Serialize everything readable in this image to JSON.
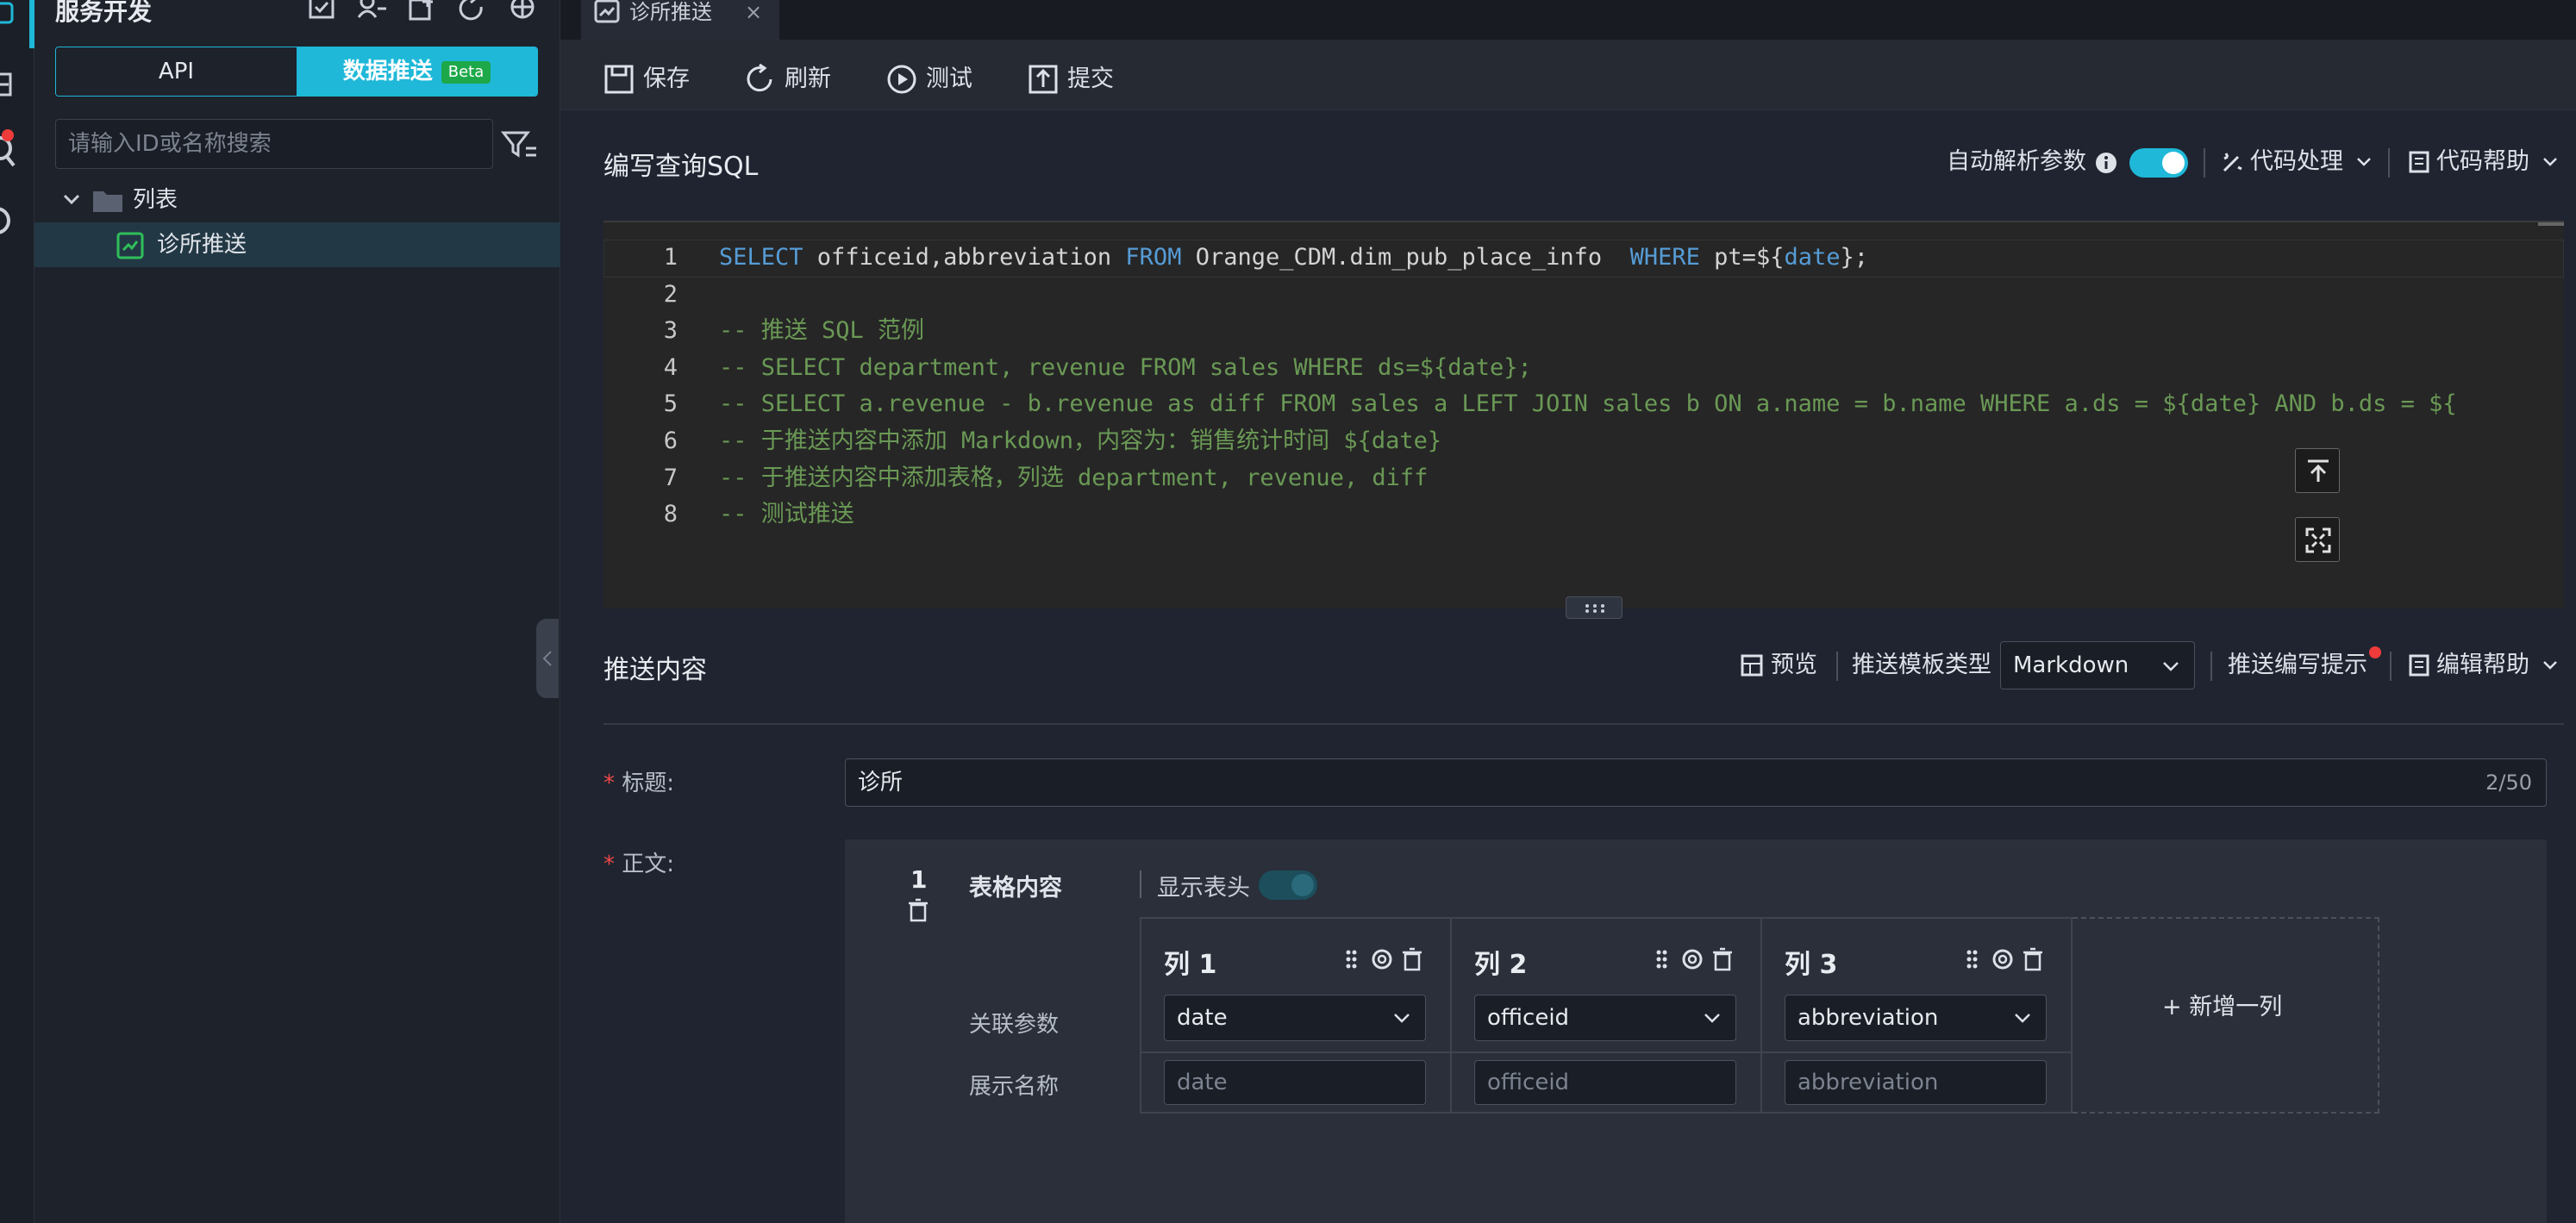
{
  "sidebar": {
    "title": "服务开发",
    "segments": [
      {
        "label": "API",
        "active": false
      },
      {
        "label": "数据推送",
        "badge": "Beta",
        "active": true
      }
    ],
    "search_placeholder": "请输入ID或名称搜索",
    "tree": {
      "folder_label": "列表",
      "items": [
        {
          "label": "诊所推送",
          "selected": true
        }
      ]
    }
  },
  "tabs": [
    {
      "label": "诊所推送",
      "close": "×"
    }
  ],
  "toolbar": {
    "save_label": "保存",
    "refresh_label": "刷新",
    "test_label": "测试",
    "submit_label": "提交"
  },
  "sql_section": {
    "title": "编写查询SQL",
    "auto_parse_label": "自动解析参数",
    "auto_parse_on": true,
    "code_process_label": "代码处理",
    "code_help_label": "代码帮助"
  },
  "code_lines": [
    {
      "n": "1",
      "parts": [
        [
          "kw",
          "SELECT"
        ],
        [
          "tx",
          " officeid,abbreviation "
        ],
        [
          "kw",
          "FROM"
        ],
        [
          "tx",
          " Orange_CDM.dim_pub_place_info  "
        ],
        [
          "kw",
          "WHERE"
        ],
        [
          "tx",
          " pt="
        ],
        [
          "tx",
          "${"
        ],
        [
          "kw",
          "date"
        ],
        [
          "tx",
          "};"
        ]
      ]
    },
    {
      "n": "2",
      "parts": []
    },
    {
      "n": "3",
      "parts": [
        [
          "cm",
          "-- 推送 SQL 范例"
        ]
      ]
    },
    {
      "n": "4",
      "parts": [
        [
          "cm",
          "-- SELECT department, revenue FROM sales WHERE ds=${date};"
        ]
      ]
    },
    {
      "n": "5",
      "parts": [
        [
          "cm",
          "-- SELECT a.revenue - b.revenue as diff FROM sales a LEFT JOIN sales b ON a.name = b.name WHERE a.ds = ${date} AND b.ds = ${"
        ]
      ]
    },
    {
      "n": "6",
      "parts": [
        [
          "cm",
          "-- 于推送内容中添加 Markdown，内容为：销售统计时间 ${date}"
        ]
      ]
    },
    {
      "n": "7",
      "parts": [
        [
          "cm",
          "-- 于推送内容中添加表格，列选 department, revenue, diff"
        ]
      ]
    },
    {
      "n": "8",
      "parts": [
        [
          "cm",
          "-- 测试推送"
        ]
      ]
    }
  ],
  "push_section": {
    "title": "推送内容",
    "preview_label": "预览",
    "template_type_label": "推送模板类型",
    "template_type_value": "Markdown",
    "write_tips_label": "推送编写提示",
    "edit_help_label": "编辑帮助"
  },
  "form": {
    "title_label": "标题:",
    "title_value": "诊所",
    "title_counter": "2/50",
    "body_label": "正文:",
    "block_index": "1",
    "block_title": "表格内容",
    "show_header_label": "显示表头",
    "show_header_on": true,
    "row_param_label": "关联参数",
    "row_display_label": "展示名称",
    "add_column_label": "+ 新增一列",
    "columns": [
      {
        "title": "列 1",
        "param": "date",
        "display_placeholder": "date"
      },
      {
        "title": "列 2",
        "param": "officeid",
        "display_placeholder": "officeid"
      },
      {
        "title": "列 3",
        "param": "abbreviation",
        "display_placeholder": "abbreviation"
      }
    ]
  },
  "colors": {
    "accent": "#1fb8d8",
    "required": "#f04848",
    "keyword": "#569cd6",
    "comment": "#6a9955"
  }
}
